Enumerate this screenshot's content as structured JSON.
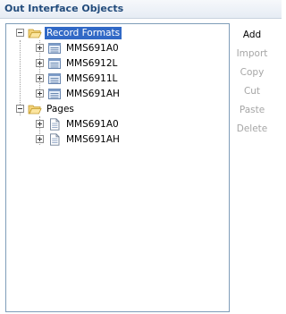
{
  "panel": {
    "title": "Out Interface Objects"
  },
  "tree": {
    "groups": [
      {
        "label": "Record Formats",
        "expanded": true,
        "selected": true,
        "icon": "folder-open-icon",
        "children": [
          {
            "label": "MMS691A0",
            "icon": "record-format-icon"
          },
          {
            "label": "MMS6912L",
            "icon": "record-format-icon"
          },
          {
            "label": "MMS6911L",
            "icon": "record-format-icon"
          },
          {
            "label": "MMS691AH",
            "icon": "record-format-icon"
          }
        ]
      },
      {
        "label": "Pages",
        "expanded": true,
        "selected": false,
        "icon": "folder-open-icon",
        "children": [
          {
            "label": "MMS691A0",
            "icon": "page-icon"
          },
          {
            "label": "MMS691AH",
            "icon": "page-icon"
          }
        ]
      }
    ]
  },
  "actions": [
    {
      "label": "Add",
      "enabled": true
    },
    {
      "label": "Import",
      "enabled": false
    },
    {
      "label": "Copy",
      "enabled": false
    },
    {
      "label": "Cut",
      "enabled": false
    },
    {
      "label": "Paste",
      "enabled": false
    },
    {
      "label": "Delete",
      "enabled": false
    }
  ],
  "colors": {
    "title_text": "#234c7c",
    "selection": "#3169c6",
    "disabled_text": "#a6a6a6",
    "panel_border": "#7f9db9"
  }
}
